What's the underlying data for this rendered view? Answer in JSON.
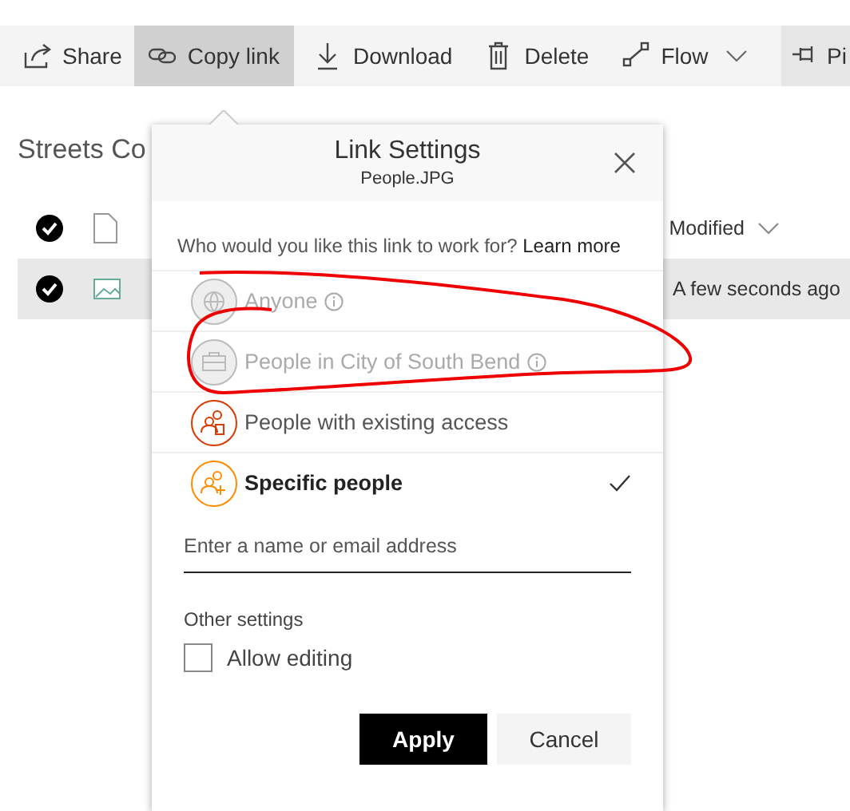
{
  "toolbar": [
    {
      "label": "Share",
      "kind": "share",
      "selected": false
    },
    {
      "label": "Copy link",
      "kind": "link",
      "selected": true
    },
    {
      "label": "Download",
      "kind": "download",
      "selected": false
    },
    {
      "label": "Delete",
      "kind": "trash",
      "selected": false
    },
    {
      "label": "Flow",
      "kind": "flow",
      "selected": false,
      "dropdown": true
    },
    {
      "label": "Pi",
      "kind": "pin",
      "selected": false
    }
  ],
  "library": {
    "title": "Streets Co",
    "header": {
      "checked": true,
      "label": "Modified"
    },
    "rows": [
      {
        "kind": "image",
        "checked": true,
        "modified": "A few seconds ago"
      }
    ]
  },
  "dialog": {
    "title": "Link Settings",
    "subtitle": "People.JPG",
    "question": "Who would you like this link to work for?",
    "learn_more": "Learn more",
    "options": [
      {
        "label": "Anyone",
        "kind": "globe",
        "disabled": true,
        "info": true,
        "selected": false
      },
      {
        "label": "People in City of South Bend",
        "kind": "briefcase",
        "disabled": true,
        "info": true,
        "selected": false
      },
      {
        "label": "People with existing access",
        "kind": "people-existing",
        "disabled": false,
        "info": false,
        "selected": false
      },
      {
        "label": "Specific people",
        "kind": "people-add",
        "disabled": false,
        "info": false,
        "selected": true
      }
    ],
    "recipient": {
      "placeholder": "Enter a name or email address"
    },
    "other_settings": "Other settings",
    "allow_editing": {
      "label": "Allow editing",
      "checked": false
    },
    "buttons": [
      {
        "label": "Apply",
        "kind": "primary"
      },
      {
        "label": "Cancel",
        "kind": "secondary"
      }
    ]
  }
}
